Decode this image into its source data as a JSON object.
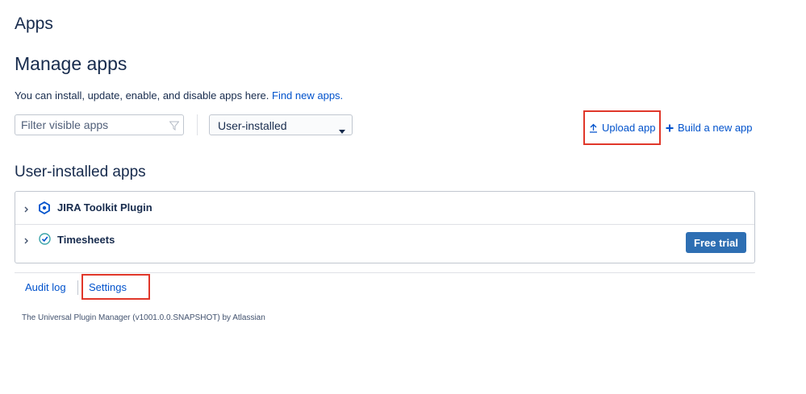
{
  "page": {
    "title": "Apps",
    "heading": "Manage apps",
    "description": "You can install, update, enable, and disable apps here.",
    "find_link": "Find new apps."
  },
  "toolbar": {
    "filter_placeholder": "Filter visible apps",
    "filter_icon": "funnel-icon",
    "select_value": "User-installed",
    "upload_label": "Upload app",
    "build_label": "Build a new app"
  },
  "section": {
    "title": "User-installed apps"
  },
  "apps": [
    {
      "name": "JIRA Toolkit Plugin",
      "icon": "hexagon-plugin-icon"
    },
    {
      "name": "Timesheets",
      "icon": "check-circle-icon",
      "action": "Free trial"
    }
  ],
  "footer": {
    "audit_log": "Audit log",
    "settings": "Settings",
    "version_text": "The Universal Plugin Manager (v1001.0.0.SNAPSHOT) by Atlassian"
  },
  "colors": {
    "link": "#0052cc",
    "heading": "#172b4d",
    "primary_button": "#2e6fb3",
    "highlight_box": "#e0372a"
  }
}
